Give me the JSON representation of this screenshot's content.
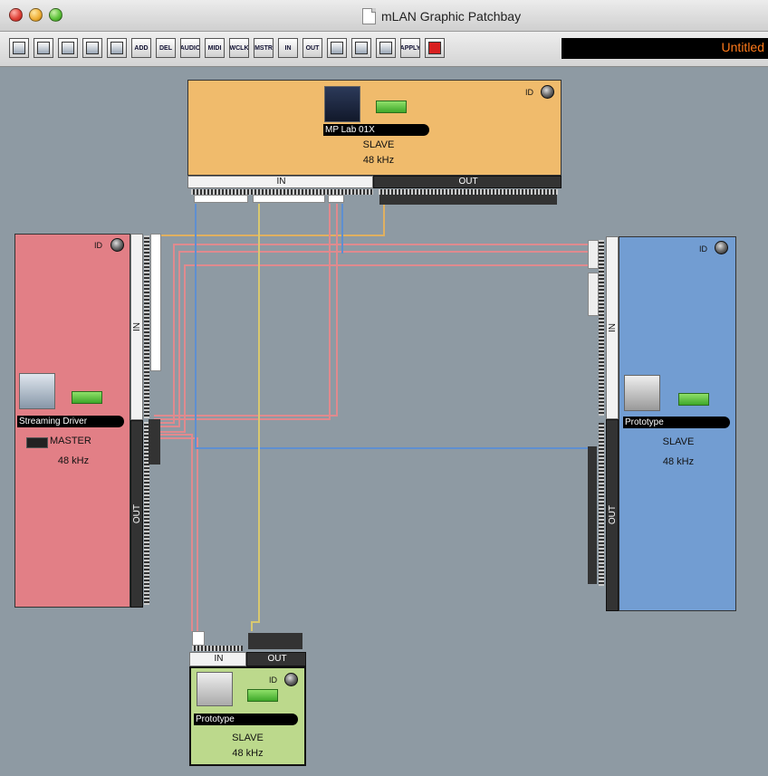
{
  "window": {
    "title": "mLAN Graphic Patchbay"
  },
  "toolbar": {
    "document_name": "Untitled",
    "buttons": [
      {
        "name": "new-document-icon",
        "text": ""
      },
      {
        "name": "open-folder-icon",
        "text": ""
      },
      {
        "name": "save-disk-icon",
        "text": ""
      },
      {
        "name": "export-icon",
        "text": ""
      },
      {
        "name": "copy-icon",
        "text": ""
      },
      {
        "name": "add-device-icon",
        "text": "ADD"
      },
      {
        "name": "delete-device-icon",
        "text": "DEL"
      },
      {
        "name": "audio-icon",
        "text": "AUDIO"
      },
      {
        "name": "midi-icon",
        "text": "MIDI"
      },
      {
        "name": "wordclock-icon",
        "text": "WCLK"
      },
      {
        "name": "master-icon",
        "text": "MSTR"
      },
      {
        "name": "input-icon",
        "text": "IN"
      },
      {
        "name": "output-icon",
        "text": "OUT"
      },
      {
        "name": "window-icon",
        "text": ""
      },
      {
        "name": "layout-icon",
        "text": ""
      },
      {
        "name": "refresh-icon",
        "text": ""
      },
      {
        "name": "apply-icon",
        "text": "APPLY"
      },
      {
        "name": "record-icon",
        "text": ""
      }
    ]
  },
  "devices": {
    "mp_lab": {
      "name": "MP Lab 01X",
      "mode": "SLAVE",
      "rate": "48 kHz",
      "id_label": "ID",
      "in_label": "IN",
      "out_label": "OUT",
      "color": "#f0bb6c"
    },
    "streaming": {
      "name": "Streaming Driver",
      "mode": "MASTER",
      "rate": "48 kHz",
      "id_label": "ID",
      "in_label": "IN",
      "out_label": "OUT",
      "color": "#e27f86"
    },
    "proto_right": {
      "name": "Prototype",
      "mode": "SLAVE",
      "rate": "48 kHz",
      "id_label": "ID",
      "in_label": "IN",
      "out_label": "OUT",
      "color": "#729dd2"
    },
    "proto_bottom": {
      "name": "Prototype",
      "mode": "SLAVE",
      "rate": "48 kHz",
      "id_label": "ID",
      "in_label": "IN",
      "out_label": "OUT",
      "color": "#bcd98c"
    }
  },
  "colors": {
    "canvas": "#8e9aa3",
    "cable_red": "#e08a8e",
    "cable_blue": "#5f8fd0",
    "cable_yellow": "#d8c870",
    "cable_orange": "#e0b060"
  }
}
